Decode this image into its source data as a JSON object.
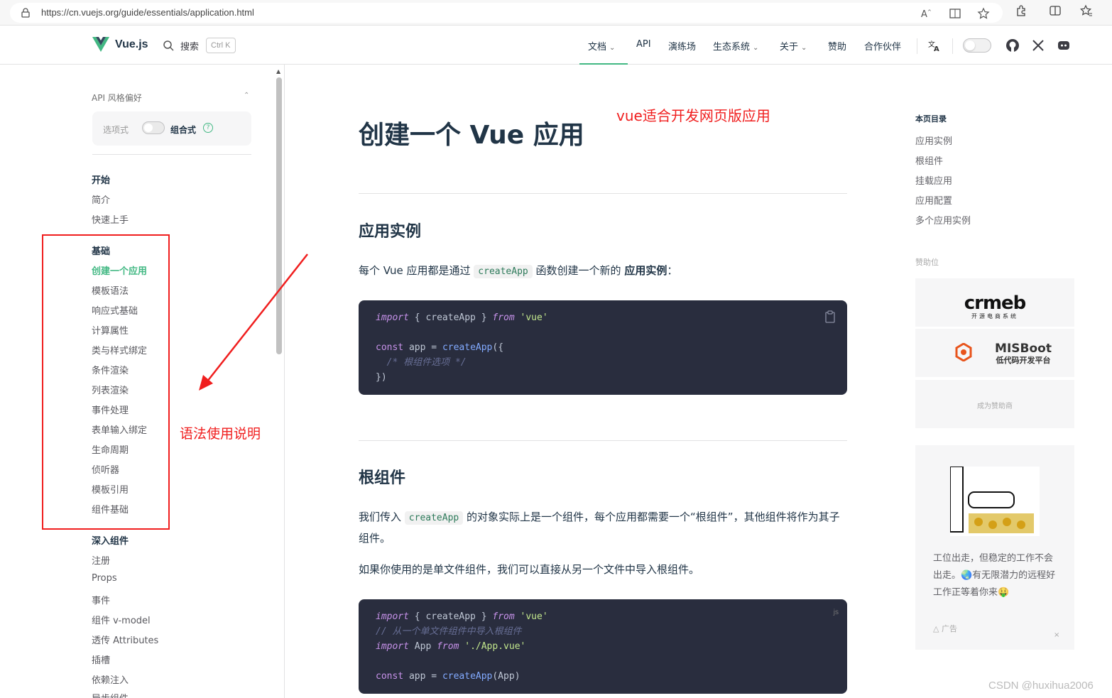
{
  "browser": {
    "url": "https://cn.vuejs.org/guide/essentials/application.html"
  },
  "nav": {
    "brand": "Vue.js",
    "search_label": "搜索",
    "search_kbd": "Ctrl K",
    "items": [
      {
        "label": "文档",
        "has_dropdown": true
      },
      {
        "label": "API",
        "has_dropdown": false
      },
      {
        "label": "演练场",
        "has_dropdown": false
      },
      {
        "label": "生态系统",
        "has_dropdown": true
      },
      {
        "label": "关于",
        "has_dropdown": true
      },
      {
        "label": "赞助",
        "has_dropdown": false
      },
      {
        "label": "合作伙伴",
        "has_dropdown": false
      }
    ],
    "icons": [
      "translate-icon",
      "theme-toggle",
      "github-icon",
      "x-icon",
      "discord-icon"
    ]
  },
  "sidebar": {
    "api_pref_label": "API 风格偏好",
    "option_a": "选项式",
    "option_b": "组合式",
    "sections": [
      {
        "title": "开始",
        "items": [
          "简介",
          "快速上手"
        ]
      },
      {
        "title": "基础",
        "items": [
          "创建一个应用",
          "模板语法",
          "响应式基础",
          "计算属性",
          "类与样式绑定",
          "条件渲染",
          "列表渲染",
          "事件处理",
          "表单输入绑定",
          "生命周期",
          "侦听器",
          "模板引用",
          "组件基础"
        ]
      },
      {
        "title": "深入组件",
        "items": [
          "注册",
          "Props",
          "事件",
          "组件 v-model",
          "透传 Attributes",
          "插槽",
          "依赖注入",
          "异步组件"
        ]
      }
    ],
    "active_item": "创建一个应用"
  },
  "annotations": {
    "note_sidebar": "语法使用说明",
    "note_title": "vue适合开发网页版应用"
  },
  "main": {
    "title": "创建一个 Vue 应用",
    "section1_title": "应用实例",
    "section1_p_pre": "每个 Vue 应用都是通过",
    "section1_code": "createApp",
    "section1_p_mid": "函数创建一个新的",
    "section1_p_bold": "应用实例",
    "section1_p_end": "：",
    "code1": {
      "line1_kw1": "import",
      "line1_mid": " { createApp } ",
      "line1_kw2": "from",
      "line1_str": " 'vue'",
      "line3_kw": "const",
      "line3_mid": " app = ",
      "line3_fn": "createApp",
      "line3_end": "({",
      "line4_cm": "  /* 根组件选项 */",
      "line5": "})"
    },
    "section2_title": "根组件",
    "section2_p1_pre": "我们传入",
    "section2_p1_code": "createApp",
    "section2_p1_post": "的对象实际上是一个组件，每个应用都需要一个“根组件”，其他组件将作为其子组件。",
    "section2_p2": "如果你使用的是单文件组件，我们可以直接从另一个文件中导入根组件。",
    "code2": {
      "lang": "js",
      "line1_kw1": "import",
      "line1_mid": " { createApp } ",
      "line1_kw2": "from",
      "line1_str": " 'vue'",
      "line2_cm": "// 从一个单文件组件中导入根组件",
      "line3_kw1": "import",
      "line3_mid": " App ",
      "line3_kw2": "from",
      "line3_str": " './App.vue'",
      "line5_kw": "const",
      "line5_mid": " app = ",
      "line5_fn": "createApp",
      "line5_end": "(App)"
    }
  },
  "aside": {
    "toc_title": "本页目录",
    "toc": [
      "应用实例",
      "根组件",
      "挂载应用",
      "应用配置",
      "多个应用实例"
    ],
    "sponsor_title": "赞助位",
    "sponsor1": "crmeb",
    "sponsor1_sub": "开源电商系统",
    "sponsor2": "MISBoot",
    "sponsor2_sub": "低代码开发平台",
    "sponsor_become": "成为赞助商",
    "ad_text": "工位出走，但稳定的工作不会出走。🌏有无限潜力的远程好工作正等着你来🤑",
    "ad_label": "广告",
    "ad_close": "×"
  },
  "watermark": "CSDN @huxihua2006",
  "colors": {
    "accent": "#42b883",
    "annotation_red": "#f01e1e",
    "code_bg": "#292d3e"
  }
}
